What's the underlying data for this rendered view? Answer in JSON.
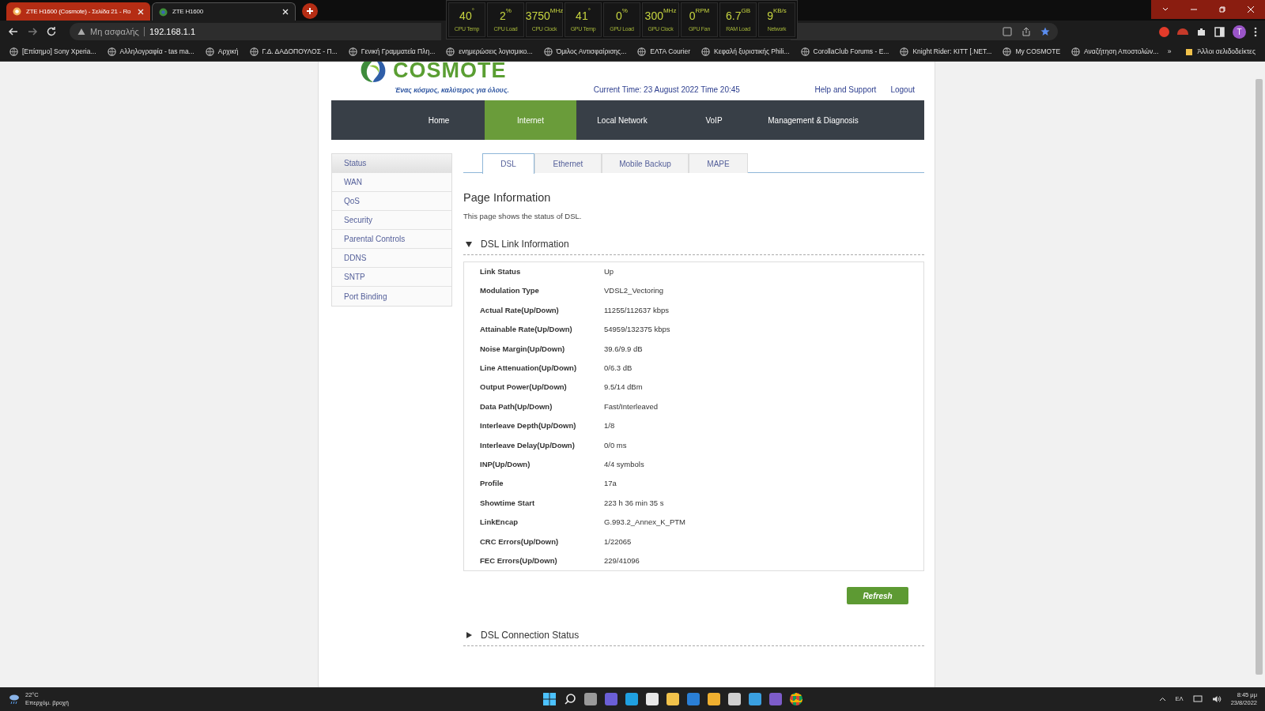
{
  "browser": {
    "tabs": [
      {
        "title": "ZTE H1600 (Cosmote) - Σελίδα 21 - Ro",
        "selected": false
      },
      {
        "title": "ZTE H1600",
        "selected": true
      }
    ],
    "address": {
      "security": "Μη ασφαλής",
      "url": "192.168.1.1"
    },
    "bookmarks": [
      "[Επίσημο] Sony Xperia...",
      "Αλληλογραφία - tas ma...",
      "Αρχική",
      "Γ.Δ. ΔΑΔΟΠΟΥΛΟΣ - Π...",
      "Γενική Γραμματεία Πλη...",
      "ενημερώσεις λογισμικο...",
      "Όμιλος Αντισφαίρισης...",
      "ΕΛΤΑ Courier",
      "Κεφαλή ξυριστικής Phili...",
      "CorollaClub Forums - E...",
      "Knight Rider: KITT [.NET...",
      "My COSMOTE",
      "Αναζήτηση Αποστολών..."
    ],
    "bookmarks_more": "»",
    "other_bookmarks": "Άλλοι σελιδοδείκτες",
    "profile_initial": "T"
  },
  "monitor": [
    {
      "value": "40",
      "unit": "°",
      "label": "CPU Temp"
    },
    {
      "value": "2",
      "unit": "%",
      "label": "CPU Load"
    },
    {
      "value": "3750",
      "unit": "MHz",
      "label": "CPU Clock"
    },
    {
      "value": "41",
      "unit": "°",
      "label": "GPU Temp"
    },
    {
      "value": "0",
      "unit": "%",
      "label": "GPU Load"
    },
    {
      "value": "300",
      "unit": "MHz",
      "label": "GPU Clock"
    },
    {
      "value": "0",
      "unit": "RPM",
      "label": "GPU Fan"
    },
    {
      "value": "6.7",
      "unit": "GB",
      "label": "RAM Load"
    },
    {
      "value": "9",
      "unit": "KB/s",
      "label": "Network"
    }
  ],
  "header": {
    "brand": "COSMOTE",
    "tagline": "Ένας κόσμος, καλύτερος για όλους.",
    "current_time": "Current Time: 23 August 2022 Time 20:45",
    "links": [
      "Help and Support",
      "Logout"
    ]
  },
  "nav": [
    {
      "label": "Home",
      "selected": false
    },
    {
      "label": "Internet",
      "selected": true
    },
    {
      "label": "Local Network",
      "selected": false
    },
    {
      "label": "VoIP",
      "selected": false
    },
    {
      "label": "Management & Diagnosis",
      "selected": false
    }
  ],
  "sidebar": [
    {
      "label": "Status",
      "selected": true
    },
    {
      "label": "WAN",
      "selected": false
    },
    {
      "label": "QoS",
      "selected": false
    },
    {
      "label": "Security",
      "selected": false
    },
    {
      "label": "Parental Controls",
      "selected": false
    },
    {
      "label": "DDNS",
      "selected": false
    },
    {
      "label": "SNTP",
      "selected": false
    },
    {
      "label": "Port Binding",
      "selected": false
    }
  ],
  "tabs": [
    {
      "label": "DSL",
      "selected": true
    },
    {
      "label": "Ethernet",
      "selected": false
    },
    {
      "label": "Mobile Backup",
      "selected": false
    },
    {
      "label": "MAPE",
      "selected": false
    }
  ],
  "page": {
    "title": "Page Information",
    "description": "This page shows the status of DSL."
  },
  "link_section": {
    "title": "DSL Link Information",
    "expanded": true,
    "rows": [
      [
        "Link Status",
        "Up"
      ],
      [
        "Modulation Type",
        "VDSL2_Vectoring"
      ],
      [
        "Actual Rate(Up/Down)",
        "11255/112637 kbps"
      ],
      [
        "Attainable Rate(Up/Down)",
        "54959/132375 kbps"
      ],
      [
        "Noise Margin(Up/Down)",
        "39.6/9.9 dB"
      ],
      [
        "Line Attenuation(Up/Down)",
        "0/6.3 dB"
      ],
      [
        "Output Power(Up/Down)",
        "9.5/14 dBm"
      ],
      [
        "Data Path(Up/Down)",
        "Fast/Interleaved"
      ],
      [
        "Interleave Depth(Up/Down)",
        "1/8"
      ],
      [
        "Interleave Delay(Up/Down)",
        "0/0 ms"
      ],
      [
        "INP(Up/Down)",
        "4/4 symbols"
      ],
      [
        "Profile",
        "17a"
      ],
      [
        "Showtime Start",
        "223 h 36 min 35 s"
      ],
      [
        "LinkEncap",
        "G.993.2_Annex_K_PTM"
      ],
      [
        "CRC Errors(Up/Down)",
        "1/22065"
      ],
      [
        "FEC Errors(Up/Down)",
        "229/41096"
      ]
    ]
  },
  "refresh_button": "Refresh",
  "connection_section": {
    "title": "DSL Connection Status",
    "expanded": false
  },
  "taskbar": {
    "temperature": "22°C",
    "forecast": "Επερχόμ. βροχή",
    "language": "ΕΛ",
    "time": "8:45 μμ",
    "date": "23/8/2022"
  }
}
